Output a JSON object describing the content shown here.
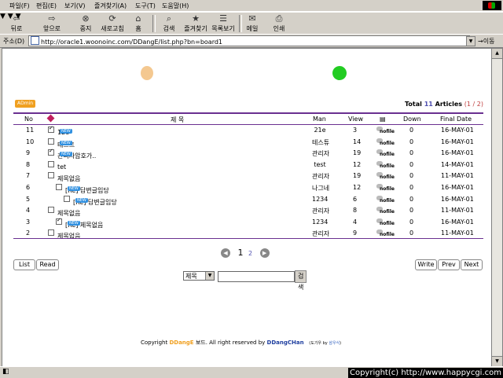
{
  "menu": [
    "파일(F)",
    "편집(E)",
    "보기(V)",
    "즐겨찾기(A)",
    "도구(T)",
    "도움말(H)"
  ],
  "toolbar": {
    "back": "뒤로",
    "forward": "앞으로",
    "stop": "중지",
    "refresh": "새로고침",
    "home": "홈",
    "search": "검색",
    "favorites": "즐겨찾기",
    "history": "목록보기",
    "mail": "메일",
    "print": "인쇄"
  },
  "address": {
    "label": "주소(D)",
    "url": "http://oracle1.woonoinc.com/DDangE/list.php?bn=board1",
    "go": "이동"
  },
  "board": {
    "admin_label": "ADmin",
    "total_prefix": "Total",
    "total_count": "11",
    "total_suffix": "Articles",
    "pages": "(1 / 2)",
    "headers": {
      "no": "No",
      "subject": "제 목",
      "man": "Man",
      "view": "View",
      "down": "Down",
      "date": "Final Date"
    },
    "new_badge": "NEW",
    "nofile_label": "nofile",
    "rows": [
      {
        "no": "11",
        "subject": "12e",
        "man": "21e",
        "view": "3",
        "down": "0",
        "date": "16-MAY-01",
        "checked": true,
        "new": true,
        "indent": 0
      },
      {
        "no": "10",
        "subject": "테스트",
        "man": "테스튜",
        "view": "14",
        "down": "0",
        "date": "16-MAY-01",
        "checked": false,
        "new": true,
        "indent": 0
      },
      {
        "no": "9",
        "subject": "관리자암호가..",
        "man": "관리자",
        "view": "19",
        "down": "0",
        "date": "16-MAY-01",
        "checked": true,
        "new": true,
        "indent": 0
      },
      {
        "no": "8",
        "subject": "tet",
        "man": "test",
        "view": "12",
        "down": "0",
        "date": "14-MAY-01",
        "checked": false,
        "new": false,
        "indent": 0
      },
      {
        "no": "7",
        "subject": "제목없음",
        "man": "관리자",
        "view": "19",
        "down": "0",
        "date": "11-MAY-01",
        "checked": false,
        "new": false,
        "indent": 0
      },
      {
        "no": "6",
        "subject": "[Re] 답변글임당",
        "man": "나그네",
        "view": "12",
        "down": "0",
        "date": "16-MAY-01",
        "checked": false,
        "new": true,
        "indent": 1
      },
      {
        "no": "5",
        "subject": "[Re] 답변글임당",
        "man": "1234",
        "view": "6",
        "down": "0",
        "date": "16-MAY-01",
        "checked": false,
        "new": true,
        "indent": 2
      },
      {
        "no": "4",
        "subject": "제목없음",
        "man": "관리자",
        "view": "8",
        "down": "0",
        "date": "11-MAY-01",
        "checked": false,
        "new": false,
        "indent": 0
      },
      {
        "no": "3",
        "subject": "[Re] 제목없음",
        "man": "1234",
        "view": "4",
        "down": "0",
        "date": "16-MAY-01",
        "checked": true,
        "new": true,
        "indent": 1
      },
      {
        "no": "2",
        "subject": "제목없음",
        "man": "관리자",
        "view": "9",
        "down": "0",
        "date": "11-MAY-01",
        "checked": false,
        "new": false,
        "indent": 0
      }
    ],
    "pager": {
      "current": "1",
      "next": "2"
    },
    "buttons": {
      "list": "List",
      "read": "Read",
      "write": "Write",
      "prev": "Prev",
      "next": "Next"
    },
    "search": {
      "field": "제목",
      "button": "검색"
    }
  },
  "footer": {
    "prefix": "Copyright",
    "brand": "DDangE",
    "mid": "보드. All right reserved by",
    "author": "DDangCHan",
    "small_prefix": "(도기우 by",
    "small_name": "삼우식",
    "small_suffix": ")"
  },
  "status": {
    "copyright": "Copyright(c) http://www.happycgi.com"
  },
  "colors": {
    "accent": "#6a3090",
    "admin": "#f0a020",
    "new": "#3090e0"
  }
}
